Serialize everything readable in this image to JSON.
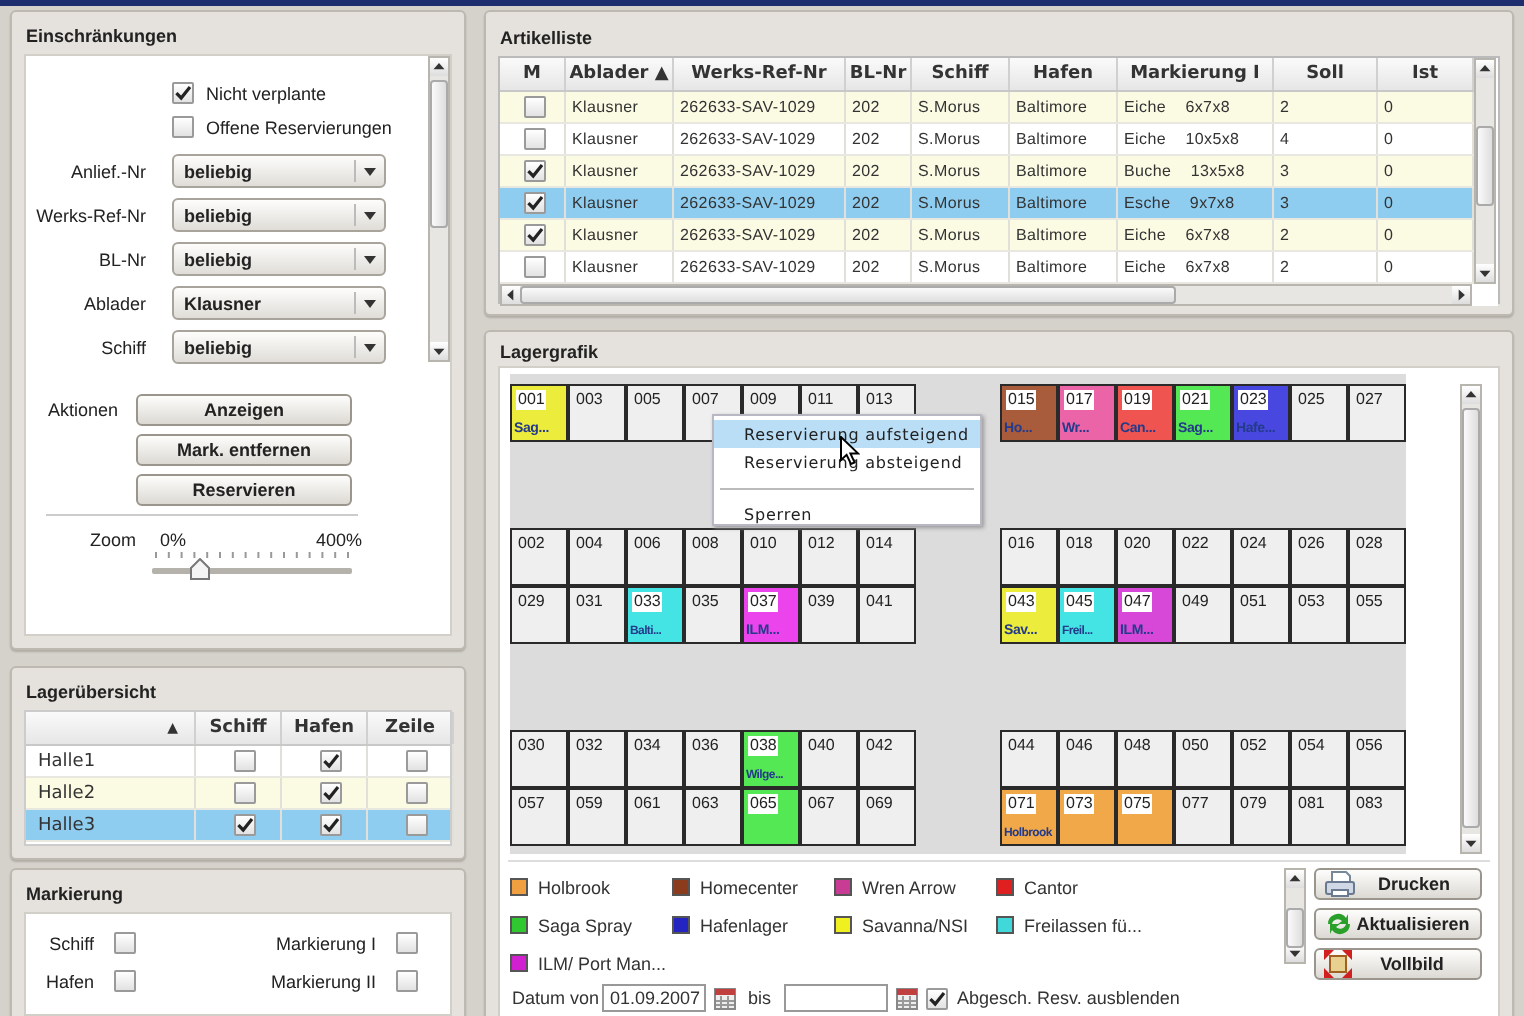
{
  "filters": {
    "title": "Einschränkungen",
    "checkboxes": [
      {
        "label": "Nicht verplante",
        "checked": true
      },
      {
        "label": "Offene Reservierungen",
        "checked": false
      }
    ],
    "dropdowns": [
      {
        "label": "Anlief.-Nr",
        "value": "beliebig"
      },
      {
        "label": "Werks-Ref-Nr",
        "value": "beliebig"
      },
      {
        "label": "BL-Nr",
        "value": "beliebig"
      },
      {
        "label": "Ablader",
        "value": "Klausner"
      },
      {
        "label": "Schiff",
        "value": "beliebig"
      }
    ],
    "actions_label": "Aktionen",
    "buttons": [
      "Anzeigen",
      "Mark. entfernen",
      "Reservieren"
    ],
    "zoom": {
      "label": "Zoom",
      "min_label": "0%",
      "max_label": "400%",
      "level": 0.24
    }
  },
  "hall_overview": {
    "title": "Lagerübersicht",
    "columns": [
      "▲",
      "Schiff",
      "Hafen",
      "Zeile"
    ],
    "rows": [
      {
        "name": "Halle1",
        "schiff": false,
        "hafen": true,
        "zeile": false,
        "selected": false
      },
      {
        "name": "Halle2",
        "schiff": false,
        "hafen": true,
        "zeile": false,
        "selected": false
      },
      {
        "name": "Halle3",
        "schiff": true,
        "hafen": true,
        "zeile": false,
        "selected": true
      }
    ]
  },
  "marking": {
    "title": "Markierung",
    "options": [
      {
        "label": "Schiff",
        "checked": false
      },
      {
        "label": "Markierung I",
        "checked": false
      },
      {
        "label": "Hafen",
        "checked": false
      },
      {
        "label": "Markierung II",
        "checked": false
      }
    ]
  },
  "article_list": {
    "title": "Artikelliste",
    "columns": [
      "M",
      "Ablader ▲",
      "Werks-Ref-Nr",
      "BL-Nr",
      "Schiff",
      "Hafen",
      "Markierung I",
      "Soll",
      "Ist"
    ],
    "rows": [
      {
        "m": false,
        "ablader": "Klausner",
        "werks_ref_nr": "262633-SAV-1029",
        "bl_nr": "202",
        "schiff": "S.Morus",
        "hafen": "Baltimore",
        "markierung_i": "Eiche    6x7x8",
        "soll": "2",
        "ist": "0",
        "selected": false
      },
      {
        "m": false,
        "ablader": "Klausner",
        "werks_ref_nr": "262633-SAV-1029",
        "bl_nr": "202",
        "schiff": "S.Morus",
        "hafen": "Baltimore",
        "markierung_i": "Eiche    10x5x8",
        "soll": "4",
        "ist": "0",
        "selected": false
      },
      {
        "m": true,
        "ablader": "Klausner",
        "werks_ref_nr": "262633-SAV-1029",
        "bl_nr": "202",
        "schiff": "S.Morus",
        "hafen": "Baltimore",
        "markierung_i": "Buche    13x5x8",
        "soll": "3",
        "ist": "0",
        "selected": false
      },
      {
        "m": true,
        "ablader": "Klausner",
        "werks_ref_nr": "262633-SAV-1029",
        "bl_nr": "202",
        "schiff": "S.Morus",
        "hafen": "Baltimore",
        "markierung_i": "Esche    9x7x8",
        "soll": "3",
        "ist": "0",
        "selected": true
      },
      {
        "m": true,
        "ablader": "Klausner",
        "werks_ref_nr": "262633-SAV-1029",
        "bl_nr": "202",
        "schiff": "S.Morus",
        "hafen": "Baltimore",
        "markierung_i": "Eiche    6x7x8",
        "soll": "2",
        "ist": "0",
        "selected": false
      },
      {
        "m": false,
        "ablader": "Klausner",
        "werks_ref_nr": "262633-SAV-1029",
        "bl_nr": "202",
        "schiff": "S.Morus",
        "hafen": "Baltimore",
        "markierung_i": "Eiche    6x7x8",
        "soll": "2",
        "ist": "0",
        "selected": false
      }
    ]
  },
  "storage_graphic": {
    "title": "Lagergrafik",
    "row_groups": [
      {
        "rows": [
          {
            "left": [
              {
                "number": "001",
                "color": "#ecec3c",
                "label": "Sag..."
              },
              {
                "number": "003"
              },
              {
                "number": "005"
              },
              {
                "number": "007"
              },
              {
                "number": "009"
              },
              {
                "number": "011"
              },
              {
                "number": "013"
              }
            ],
            "right": [
              {
                "number": "015",
                "color": "#a85c3c",
                "label": "Ho..."
              },
              {
                "number": "017",
                "color": "#ec64a8",
                "label": "Wr..."
              },
              {
                "number": "019",
                "color": "#f05450",
                "label": "Can..."
              },
              {
                "number": "021",
                "color": "#54e854",
                "label": "Sag..."
              },
              {
                "number": "023",
                "color": "#4848e0",
                "label": "Hafe..."
              },
              {
                "number": "025"
              },
              {
                "number": "027"
              }
            ]
          }
        ]
      },
      {
        "rows": [
          {
            "left": [
              {
                "number": "002"
              },
              {
                "number": "004"
              },
              {
                "number": "006"
              },
              {
                "number": "008"
              },
              {
                "number": "010"
              },
              {
                "number": "012"
              },
              {
                "number": "014"
              }
            ],
            "right": [
              {
                "number": "016"
              },
              {
                "number": "018"
              },
              {
                "number": "020"
              },
              {
                "number": "022"
              },
              {
                "number": "024"
              },
              {
                "number": "026"
              },
              {
                "number": "028"
              }
            ]
          },
          {
            "left": [
              {
                "number": "029"
              },
              {
                "number": "031"
              },
              {
                "number": "033",
                "color": "#44e4e4",
                "label": "Balti..."
              },
              {
                "number": "035"
              },
              {
                "number": "037",
                "color": "#ec44ec",
                "label": "ILM..."
              },
              {
                "number": "039"
              },
              {
                "number": "041"
              }
            ],
            "right": [
              {
                "number": "043",
                "color": "#ecec3c",
                "label": "Sav..."
              },
              {
                "number": "045",
                "color": "#44e4e4",
                "label": "Freil..."
              },
              {
                "number": "047",
                "color": "#d848d8",
                "label": "ILM..."
              },
              {
                "number": "049"
              },
              {
                "number": "051"
              },
              {
                "number": "053"
              },
              {
                "number": "055"
              }
            ]
          }
        ]
      },
      {
        "rows": [
          {
            "left": [
              {
                "number": "030"
              },
              {
                "number": "032"
              },
              {
                "number": "034"
              },
              {
                "number": "036"
              },
              {
                "number": "038",
                "color": "#54e854",
                "label": "Wilge..."
              },
              {
                "number": "040"
              },
              {
                "number": "042"
              }
            ],
            "right": [
              {
                "number": "044"
              },
              {
                "number": "046"
              },
              {
                "number": "048"
              },
              {
                "number": "050"
              },
              {
                "number": "052"
              },
              {
                "number": "054"
              },
              {
                "number": "056"
              }
            ]
          },
          {
            "left": [
              {
                "number": "057"
              },
              {
                "number": "059"
              },
              {
                "number": "061"
              },
              {
                "number": "063"
              },
              {
                "number": "065",
                "color": "#54e854"
              },
              {
                "number": "067"
              },
              {
                "number": "069"
              }
            ],
            "right": [
              {
                "number": "071",
                "color": "#f0a848",
                "label": "Holbrook"
              },
              {
                "number": "073",
                "color": "#f0a848"
              },
              {
                "number": "075",
                "color": "#f0a848"
              },
              {
                "number": "077"
              },
              {
                "number": "079"
              },
              {
                "number": "081"
              },
              {
                "number": "083"
              }
            ]
          }
        ]
      }
    ],
    "context_menu": [
      {
        "kind": "item",
        "label": "Reservierung aufsteigend",
        "highlighted": true
      },
      {
        "kind": "item",
        "label": "Reservierung absteigend",
        "highlighted": false
      },
      {
        "kind": "separator"
      },
      {
        "kind": "item",
        "label": "Sperren",
        "highlighted": false
      }
    ],
    "legend": [
      {
        "label": "Holbrook",
        "color": "#f0a040"
      },
      {
        "label": "Homecenter",
        "color": "#8c3c1c"
      },
      {
        "label": "Wren Arrow",
        "color": "#c83c94"
      },
      {
        "label": "Cantor",
        "color": "#e02020"
      },
      {
        "label": "Saga Spray",
        "color": "#30c830"
      },
      {
        "label": "Hafenlager",
        "color": "#2424c0"
      },
      {
        "label": "Savanna/NSI",
        "color": "#f0f020"
      },
      {
        "label": "Freilassen fü...",
        "color": "#40d8d8"
      },
      {
        "label": "ILM/ Port Man...",
        "color": "#d020d0"
      }
    ],
    "buttons": [
      {
        "label": "Drucken",
        "kind": "print"
      },
      {
        "label": "Aktualisieren",
        "kind": "refresh"
      },
      {
        "label": "Vollbild",
        "kind": "fullscreen"
      }
    ],
    "date_filter": {
      "from_label": "Datum von",
      "from_value": "01.09.2007",
      "to_label": "bis",
      "hide_completed": {
        "label": "Abgesch. Resv. ausblenden",
        "checked": true
      }
    }
  }
}
